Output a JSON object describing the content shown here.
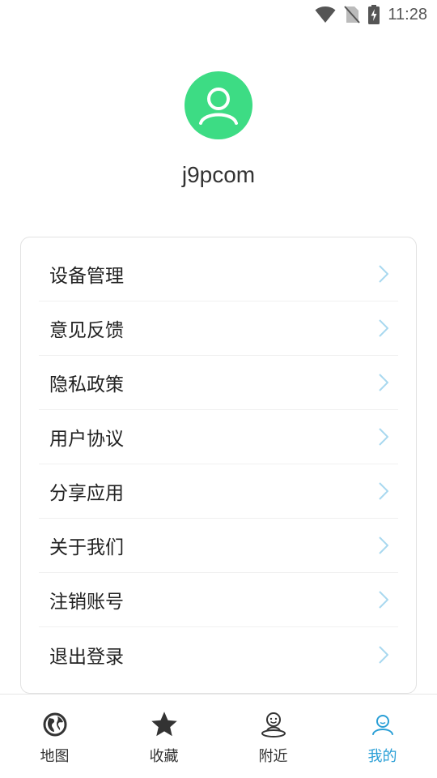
{
  "status_bar": {
    "time": "11:28"
  },
  "profile": {
    "username": "j9pcom"
  },
  "menu": {
    "items": [
      {
        "label": "设备管理"
      },
      {
        "label": "意见反馈"
      },
      {
        "label": "隐私政策"
      },
      {
        "label": "用户协议"
      },
      {
        "label": "分享应用"
      },
      {
        "label": "关于我们"
      },
      {
        "label": "注销账号"
      },
      {
        "label": "退出登录"
      }
    ]
  },
  "tab_bar": {
    "tabs": [
      {
        "label": "地图",
        "icon": "globe-icon"
      },
      {
        "label": "收藏",
        "icon": "star-icon"
      },
      {
        "label": "附近",
        "icon": "person-location-icon"
      },
      {
        "label": "我的",
        "icon": "user-icon",
        "active": true
      }
    ]
  },
  "colors": {
    "avatar_bg": "#3ddc84",
    "accent": "#2a9fd6",
    "chevron": "#a8d8ef"
  }
}
